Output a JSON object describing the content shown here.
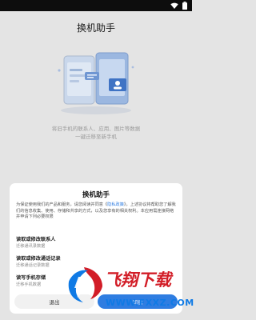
{
  "app": {
    "title": "换机助手"
  },
  "intro": {
    "line1": "将旧手机的联系人、应用、图片等数据",
    "line2": "一键迁移至新手机"
  },
  "dialog": {
    "title": "换机助手",
    "consent": {
      "part1": "为保证使用我们的产品和服务，请您阅读并同意《",
      "link": "隐私政策",
      "part2": "》，上述协议将帮助您了解我们的信息收集、使用、存储和共享的方式，以及您享有的相关权利。本应用需连接网络并申请下列必要权限"
    },
    "permissions": [
      {
        "title": "读取或修改联系人",
        "desc": "迁移通讯录数据"
      },
      {
        "title": "读取或修改通话记录",
        "desc": "迁移通话记录数据"
      },
      {
        "title": "读写手机存储",
        "desc": "迁移手机数据"
      }
    ],
    "exit_label": "退出",
    "agree_label": "同意"
  },
  "watermark": {
    "title": "飞翔下载",
    "url": "WWW.FXXZ.COM"
  }
}
